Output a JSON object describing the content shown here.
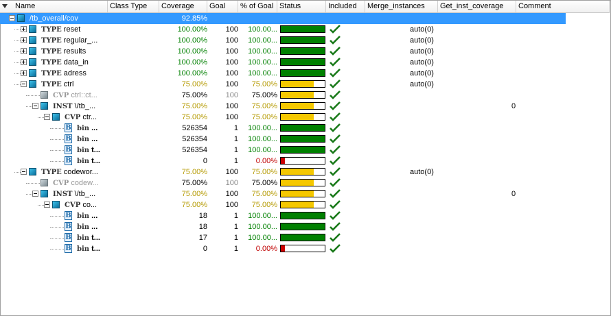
{
  "columns": [
    "Name",
    "Class Type",
    "Coverage",
    "Goal",
    "% of Goal",
    "Status",
    "Included",
    "Merge_instances",
    "Get_inst_coverage",
    "Comment"
  ],
  "colors": {
    "green": "#008000",
    "yellow": "#f5c800",
    "red": "#cc0000",
    "olive": "#b59a00",
    "pct_green": "#008000",
    "pct_red": "#c00000",
    "selected": "#3399ff"
  },
  "rows": [
    {
      "level": 0,
      "expander": "minus",
      "icon": "folder",
      "kw": "",
      "label": "/tb_overall/cov",
      "class_type": "",
      "coverage": "92.85%",
      "goal": "",
      "pct": "",
      "status": null,
      "included": false,
      "merge": "",
      "inst": "",
      "selected": true
    },
    {
      "level": 1,
      "expander": "plus",
      "icon": "type",
      "kw": "TYPE",
      "label": "reset",
      "coverage": "100.00%",
      "goal": "100",
      "pct": "100.00...",
      "status": 1.0,
      "included": true,
      "merge": "auto(0)",
      "inst": ""
    },
    {
      "level": 1,
      "expander": "plus",
      "icon": "type",
      "kw": "TYPE",
      "label": "regular_...",
      "coverage": "100.00%",
      "goal": "100",
      "pct": "100.00...",
      "status": 1.0,
      "included": true,
      "merge": "auto(0)",
      "inst": ""
    },
    {
      "level": 1,
      "expander": "plus",
      "icon": "type",
      "kw": "TYPE",
      "label": "results",
      "coverage": "100.00%",
      "goal": "100",
      "pct": "100.00...",
      "status": 1.0,
      "included": true,
      "merge": "auto(0)",
      "inst": ""
    },
    {
      "level": 1,
      "expander": "plus",
      "icon": "type",
      "kw": "TYPE",
      "label": "data_in",
      "coverage": "100.00%",
      "goal": "100",
      "pct": "100.00...",
      "status": 1.0,
      "included": true,
      "merge": "auto(0)",
      "inst": ""
    },
    {
      "level": 1,
      "expander": "plus",
      "icon": "type",
      "kw": "TYPE",
      "label": "adress",
      "coverage": "100.00%",
      "goal": "100",
      "pct": "100.00...",
      "status": 1.0,
      "included": true,
      "merge": "auto(0)",
      "inst": ""
    },
    {
      "level": 1,
      "expander": "minus",
      "icon": "type",
      "kw": "TYPE",
      "label": "ctrl",
      "coverage": "75.00%",
      "goal": "100",
      "pct": "75.00%",
      "status": 0.75,
      "included": true,
      "merge": "auto(0)",
      "inst": ""
    },
    {
      "level": 2,
      "expander": "",
      "icon": "cvp-grey",
      "kw": "CVP",
      "kwgrey": true,
      "label": "ctrl::ct...",
      "coverage": "75.00%",
      "goal": "100",
      "pct": "75.00%",
      "status": 0.75,
      "included": true,
      "merge": "",
      "inst": "",
      "black": true,
      "goalgrey": true
    },
    {
      "level": 2,
      "expander": "minus",
      "icon": "inst",
      "kw": "INST",
      "label": "\\/tb_...",
      "coverage": "75.00%",
      "goal": "100",
      "pct": "75.00%",
      "status": 0.75,
      "included": true,
      "merge": "",
      "inst": "0"
    },
    {
      "level": 3,
      "expander": "minus",
      "icon": "cvp",
      "kw": "CVP",
      "label": "ctr...",
      "coverage": "75.00%",
      "goal": "100",
      "pct": "75.00%",
      "status": 0.75,
      "included": true,
      "merge": "",
      "inst": ""
    },
    {
      "level": 4,
      "expander": "",
      "icon": "bin",
      "kw": "bin",
      "label": "...",
      "coverage": "526354",
      "goal": "1",
      "pct": "100.00...",
      "status": 1.0,
      "included": true,
      "merge": "",
      "inst": "",
      "black": true
    },
    {
      "level": 4,
      "expander": "",
      "icon": "bin",
      "kw": "bin",
      "label": "...",
      "coverage": "526354",
      "goal": "1",
      "pct": "100.00...",
      "status": 1.0,
      "included": true,
      "merge": "",
      "inst": "",
      "black": true
    },
    {
      "level": 4,
      "expander": "",
      "icon": "bin",
      "kw": "bin",
      "label": "t...",
      "coverage": "526354",
      "goal": "1",
      "pct": "100.00...",
      "status": 1.0,
      "included": true,
      "merge": "",
      "inst": "",
      "black": true
    },
    {
      "level": 4,
      "expander": "",
      "icon": "bin",
      "kw": "bin",
      "label": "t...",
      "coverage": "0",
      "goal": "1",
      "pct": "0.00%",
      "status": 0.0,
      "included": true,
      "merge": "",
      "inst": "",
      "black": true
    },
    {
      "level": 1,
      "expander": "minus",
      "icon": "type",
      "kw": "TYPE",
      "label": "codewor...",
      "coverage": "75.00%",
      "goal": "100",
      "pct": "75.00%",
      "status": 0.75,
      "included": true,
      "merge": "auto(0)",
      "inst": ""
    },
    {
      "level": 2,
      "expander": "",
      "icon": "cvp-grey",
      "kw": "CVP",
      "kwgrey": true,
      "label": "codew...",
      "coverage": "75.00%",
      "goal": "100",
      "pct": "75.00%",
      "status": 0.75,
      "included": true,
      "merge": "",
      "inst": "",
      "black": true,
      "goalgrey": true
    },
    {
      "level": 2,
      "expander": "minus",
      "icon": "inst",
      "kw": "INST",
      "label": "\\/tb_...",
      "coverage": "75.00%",
      "goal": "100",
      "pct": "75.00%",
      "status": 0.75,
      "included": true,
      "merge": "",
      "inst": "0"
    },
    {
      "level": 3,
      "expander": "minus",
      "icon": "cvp",
      "kw": "CVP",
      "label": "co...",
      "coverage": "75.00%",
      "goal": "100",
      "pct": "75.00%",
      "status": 0.75,
      "included": true,
      "merge": "",
      "inst": ""
    },
    {
      "level": 4,
      "expander": "",
      "icon": "bin",
      "kw": "bin",
      "label": "...",
      "coverage": "18",
      "goal": "1",
      "pct": "100.00...",
      "status": 1.0,
      "included": true,
      "merge": "",
      "inst": "",
      "black": true
    },
    {
      "level": 4,
      "expander": "",
      "icon": "bin",
      "kw": "bin",
      "label": "...",
      "coverage": "18",
      "goal": "1",
      "pct": "100.00...",
      "status": 1.0,
      "included": true,
      "merge": "",
      "inst": "",
      "black": true
    },
    {
      "level": 4,
      "expander": "",
      "icon": "bin",
      "kw": "bin",
      "label": "t...",
      "coverage": "17",
      "goal": "1",
      "pct": "100.00...",
      "status": 1.0,
      "included": true,
      "merge": "",
      "inst": "",
      "black": true
    },
    {
      "level": 4,
      "expander": "",
      "icon": "bin",
      "kw": "bin",
      "label": "t...",
      "coverage": "0",
      "goal": "1",
      "pct": "0.00%",
      "status": 0.0,
      "included": true,
      "merge": "",
      "inst": "",
      "black": true
    }
  ]
}
